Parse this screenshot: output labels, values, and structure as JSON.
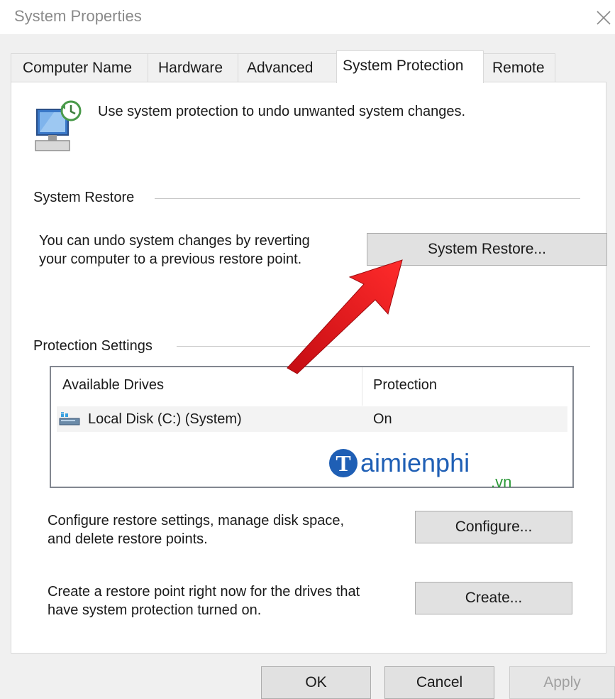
{
  "window": {
    "title": "System Properties"
  },
  "tabs": [
    {
      "label": "Computer Name",
      "active": false
    },
    {
      "label": "Hardware",
      "active": false
    },
    {
      "label": "Advanced",
      "active": false
    },
    {
      "label": "System Protection",
      "active": true
    },
    {
      "label": "Remote",
      "active": false
    }
  ],
  "intro": {
    "text": "Use system protection to undo unwanted system changes.",
    "icon": "computer-restore-icon"
  },
  "system_restore": {
    "heading": "System Restore",
    "description_line1": "You can undo system changes by reverting",
    "description_line2": "your computer to a previous restore point.",
    "button_label": "System Restore..."
  },
  "protection": {
    "heading": "Protection Settings",
    "columns": [
      "Available Drives",
      "Protection"
    ],
    "rows": [
      {
        "drive": "Local Disk (C:) (System)",
        "protection": "On",
        "icon": "drive-icon"
      }
    ]
  },
  "configure": {
    "line1": "Configure restore settings, manage disk space,",
    "line2": "and delete restore points.",
    "button_label": "Configure..."
  },
  "create": {
    "line1": "Create a restore point right now for the drives that",
    "line2": "have system protection turned on.",
    "button_label": "Create..."
  },
  "footer": {
    "ok_label": "OK",
    "cancel_label": "Cancel",
    "apply_label": "Apply"
  },
  "watermark": {
    "brand": "aimienphi",
    "brand_letter": "T",
    "suffix": ".vn"
  },
  "colors": {
    "accent_arrow": "#e8141b",
    "watermark_blue": "#1f5fb5",
    "watermark_green": "#2e9a3a"
  }
}
